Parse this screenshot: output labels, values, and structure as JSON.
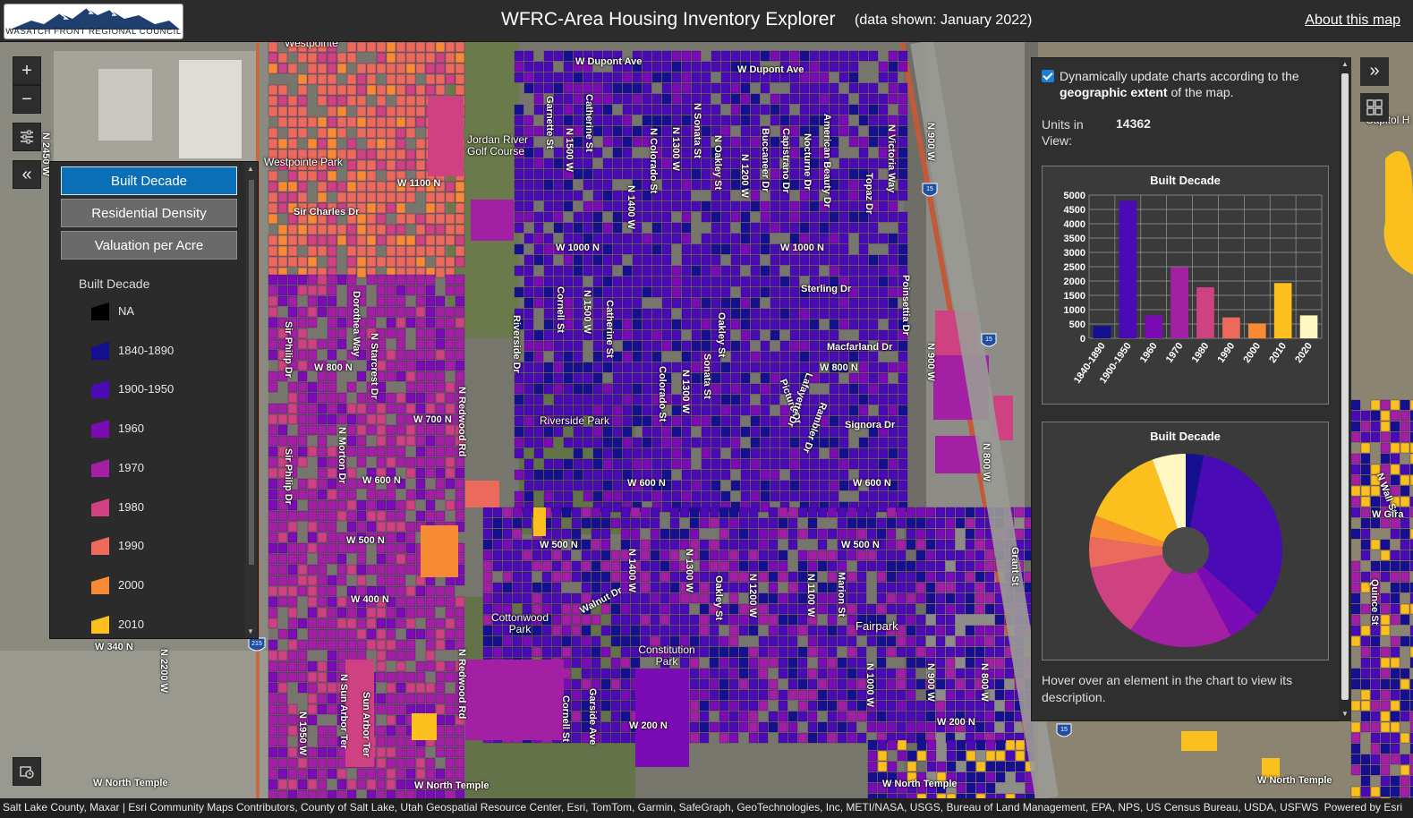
{
  "header": {
    "logo_text": "WASATCH FRONT REGIONAL COUNCIL",
    "title": "WFRC-Area Housing Inventory Explorer",
    "subtitle": "(data shown: January 2022)",
    "about_link": "About this map"
  },
  "map_controls": {
    "zoom_in": "+",
    "zoom_out": "−",
    "collapse": "«",
    "expand": "»"
  },
  "legend_panel": {
    "buttons": [
      {
        "label": "Built Decade",
        "active": true
      },
      {
        "label": "Residential Density",
        "active": false
      },
      {
        "label": "Valuation per Acre",
        "active": false
      }
    ],
    "heading": "Built Decade",
    "items": [
      {
        "label": "NA",
        "color": "#000000"
      },
      {
        "label": "1840-1890",
        "color": "#14108f"
      },
      {
        "label": "1900-1950",
        "color": "#4a0ab5"
      },
      {
        "label": "1960",
        "color": "#7b0bb4"
      },
      {
        "label": "1970",
        "color": "#a320a5"
      },
      {
        "label": "1980",
        "color": "#cf4281"
      },
      {
        "label": "1990",
        "color": "#ec6a5c"
      },
      {
        "label": "2000",
        "color": "#f78b35"
      },
      {
        "label": "2010",
        "color": "#fbbf1e"
      }
    ]
  },
  "chart_panel": {
    "dynamic_text_1": "Dynamically update charts according to the ",
    "dynamic_text_bold": "geographic extent",
    "dynamic_text_2": " of the map.",
    "units_label": "Units in View:",
    "units_value": "14362",
    "hover_text": "Hover over an element in the chart to view its description."
  },
  "chart_data": [
    {
      "type": "bar",
      "title": "Built Decade",
      "categories": [
        "1840-1890",
        "1900-1950",
        "1960",
        "1970",
        "1980",
        "1990",
        "2000",
        "2010",
        "2020"
      ],
      "values": [
        430,
        4800,
        800,
        2480,
        1780,
        730,
        520,
        1930,
        800
      ],
      "colors": [
        "#14108f",
        "#4a0ab5",
        "#7b0bb4",
        "#a320a5",
        "#cf4281",
        "#ec6a5c",
        "#f78b35",
        "#fbbf1e",
        "#fff7c2"
      ],
      "yticks": [
        0,
        500,
        1000,
        1500,
        2000,
        2500,
        3000,
        3500,
        4000,
        4500,
        5000
      ],
      "ylim": [
        0,
        5000
      ],
      "grid": true
    },
    {
      "type": "pie",
      "title": "Built Decade",
      "categories": [
        "1840-1890",
        "1900-1950",
        "1960",
        "1970",
        "1980",
        "1990",
        "2000",
        "2010",
        "2020"
      ],
      "values": [
        430,
        4800,
        800,
        2480,
        1780,
        730,
        520,
        1930,
        800
      ],
      "colors": [
        "#14108f",
        "#4a0ab5",
        "#7b0bb4",
        "#a320a5",
        "#cf4281",
        "#ec6a5c",
        "#f78b35",
        "#fbbf1e",
        "#fff7c2"
      ]
    }
  ],
  "map_labels": {
    "streets": [
      "W Dupont Ave",
      "W Dupont Ave",
      "W 1100 N",
      "Sir Charles Dr",
      "W 1000 N",
      "W 1000 N",
      "Sterling Dr",
      "Macfarland Dr",
      "W 800 N",
      "W 800 N",
      "W 700 N",
      "Signora Dr",
      "W 600 N",
      "W 600 N",
      "W 600 N",
      "W 500 N",
      "W 500 N",
      "W 500 N",
      "W 400 N",
      "W 340 N",
      "Walnut Dr",
      "W 200 N",
      "W 200 N",
      "W North Temple",
      "W North Temple",
      "W North Temple",
      "W North Temple",
      "Garnette St",
      "Catherine St",
      "N 1500 W",
      "N 1400 W",
      "N Colorado St",
      "N 1300 W",
      "N Sonata St",
      "N Oakley St",
      "N 1200 W",
      "Buccaneer Dr",
      "Capistrano Dr",
      "Nocturne Dr",
      "American Beauty Dr",
      "Topaz Dr",
      "N Victoria Way",
      "N 900 W",
      "Cornell St",
      "N 1500 W",
      "Catherine St",
      "Colorado St",
      "N 1300 W",
      "Sonata St",
      "Oakley St",
      "Picture Dr",
      "Lafayette Dr",
      "Rambler Dr",
      "Poinsettia Dr",
      "N 900 W",
      "Riverside Dr",
      "N Redwood Rd",
      "N Redwood Rd",
      "Sir Philip Dr",
      "Sir Philip Dr",
      "Dorothea Way",
      "N Starcrest Dr",
      "N Morton Dr",
      "N 2450 W",
      "N 2200 W",
      "N Sun Arbor Ter",
      "Sun Arbor Ter",
      "Cornell St",
      "Garside Ave",
      "N 1400 W",
      "N 1300 W",
      "Oakley St",
      "N 1200 W",
      "N 1100 W",
      "Marion St",
      "N 1000 W",
      "N 900 W",
      "N 800 W",
      "Grant St",
      "Quince St",
      "N 1950 W",
      "N 800 W"
    ],
    "places": [
      "Westpointe",
      "Westpointe Park",
      "Jordan River Golf Course",
      "Riverside Park",
      "Cottonwood Park",
      "Constitution Park",
      "Fairpark",
      "Capitol H",
      "N Wall St",
      "W Gira"
    ],
    "shields": [
      "15",
      "15",
      "15",
      "215",
      "215"
    ]
  },
  "attribution": {
    "text": "Salt Lake County, Maxar | Esri Community Maps Contributors, County of Salt Lake, Utah Geospatial Resource Center, Esri, TomTom, Garmin, SafeGraph, GeoTechnologies, Inc, METI/NASA, USGS, Bureau of Land Management, EPA, NPS, US Census Bureau, USDA, USFWS",
    "powered": "Powered by Esri"
  }
}
